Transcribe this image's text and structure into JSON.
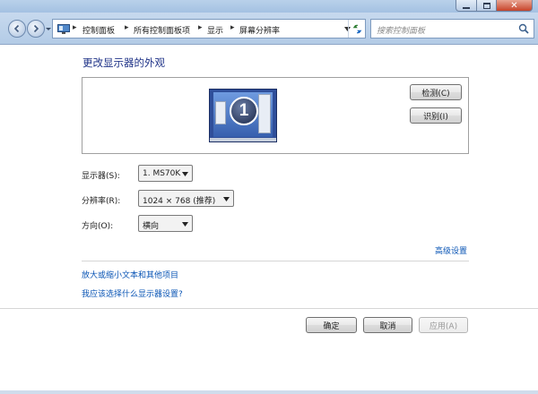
{
  "breadcrumb": {
    "items": [
      "控制面板",
      "所有控制面板项",
      "显示",
      "屏幕分辨率"
    ]
  },
  "search": {
    "placeholder": "搜索控制面板"
  },
  "main": {
    "title": "更改显示器的外观",
    "preview": {
      "monitor_number": "1",
      "detect_button": "检测(C)",
      "identify_button": "识别(I)"
    },
    "fields": {
      "display_label": "显示器(S):",
      "display_value": "1. MS70K",
      "resolution_label": "分辨率(R):",
      "resolution_value": "1024 × 768 (推荐)",
      "orientation_label": "方向(O):",
      "orientation_value": "横向"
    },
    "links": {
      "advanced": "高级设置",
      "text_size": "放大或缩小文本和其他项目",
      "help": "我应该选择什么显示器设置?"
    }
  },
  "footer": {
    "ok": "确定",
    "cancel": "取消",
    "apply": "应用(A)"
  },
  "colors": {
    "link": "#0a55b5",
    "title": "#1e3287",
    "chrome": "#b9d1ea"
  }
}
